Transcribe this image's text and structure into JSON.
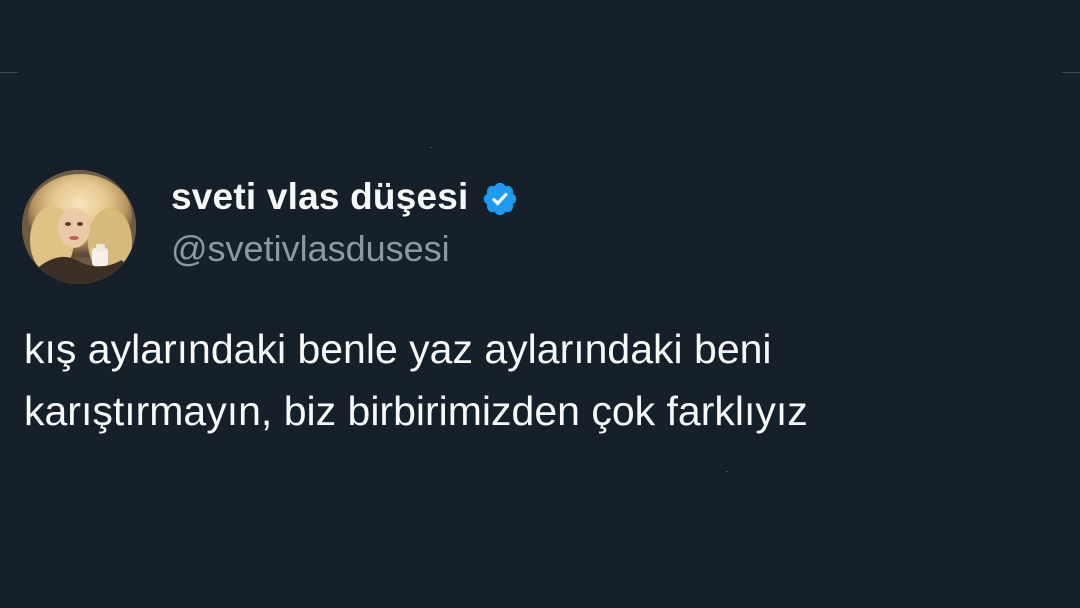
{
  "account": {
    "display_name": "sveti vlas düşesi",
    "handle": "@svetivlasdusesi",
    "verified": true
  },
  "tweet": {
    "lines": [
      "kış aylarındaki benle yaz aylarındaki beni",
      "karıştırmayın, biz birbirimizden çok farklıyız"
    ]
  },
  "colors": {
    "background": "#15202b",
    "primary_text": "#f7f9f9",
    "secondary_text": "#8b98a5",
    "verified_blue": "#1d9bf0"
  },
  "icons": {
    "verified": "verified-badge-icon"
  }
}
